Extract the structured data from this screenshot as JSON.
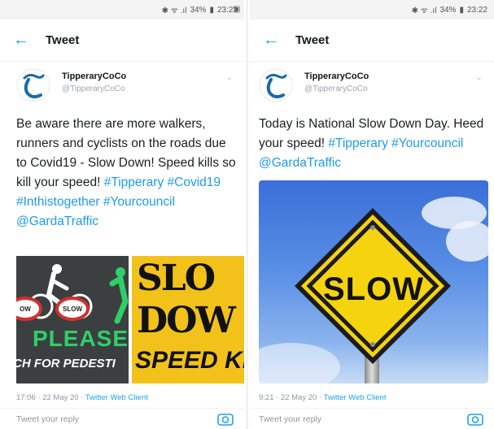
{
  "left": {
    "status": {
      "time": "23:21",
      "battery": "34%",
      "icons": "✱ ᯤ .ıl"
    },
    "status_extra": "▣",
    "header": {
      "back_icon": "arrow-left",
      "title": "Tweet"
    },
    "author": {
      "name": "TipperaryCoCo",
      "handle": "@TipperaryCoCo"
    },
    "text_segments": [
      {
        "t": "Be aware there are more walkers, runners and cyclists on the roads due to Covid19 - Slow Down! Speed kills so kill your speed! ",
        "tag": false
      },
      {
        "t": "#Tipperary",
        "tag": true
      },
      {
        "t": " ",
        "tag": false
      },
      {
        "t": "#Covid19",
        "tag": true
      },
      {
        "t": " ",
        "tag": false
      },
      {
        "t": "#Inthistogether",
        "tag": true
      },
      {
        "t": " ",
        "tag": false
      },
      {
        "t": "#Yourcouncil",
        "tag": true
      },
      {
        "t": " ",
        "tag": false
      },
      {
        "t": "@GardaTraffic",
        "tag": true
      }
    ],
    "media": {
      "left_img": {
        "word": "PLEASE",
        "line": "CH FOR PEDESTI",
        "sign1": "OW",
        "sign2": "SLOW"
      },
      "right_img": {
        "line1": "SLO",
        "line2": "DOW",
        "line3": "SPEED KI"
      }
    },
    "meta": {
      "time": "17:06 · 22 May 20 · ",
      "client": "Twitter Web Client"
    },
    "reply_placeholder": "Tweet your reply"
  },
  "right": {
    "status": {
      "time": "23:22",
      "battery": "34%",
      "icons": "✱ ᯤ .ıl"
    },
    "header": {
      "back_icon": "arrow-left",
      "title": "Tweet"
    },
    "author": {
      "name": "TipperaryCoCo",
      "handle": "@TipperaryCoCo"
    },
    "text_segments": [
      {
        "t": "Today is National Slow Down Day.  Heed your speed! ",
        "tag": false
      },
      {
        "t": "#Tipperary",
        "tag": true
      },
      {
        "t": " ",
        "tag": false
      },
      {
        "t": "#Yourcouncil",
        "tag": true
      },
      {
        "t": " ",
        "tag": false
      },
      {
        "t": "@GardaTraffic",
        "tag": true
      }
    ],
    "media": {
      "sign_text": "SLOW"
    },
    "meta": {
      "time": "9:21 · 22 May 20 · ",
      "client": "Twitter Web Client"
    },
    "reply_placeholder": "Tweet your reply"
  },
  "colors": {
    "accent": "#1da1f2",
    "sign_yellow": "#f5d40f",
    "text": "#14171a",
    "muted": "#8a97a2"
  }
}
